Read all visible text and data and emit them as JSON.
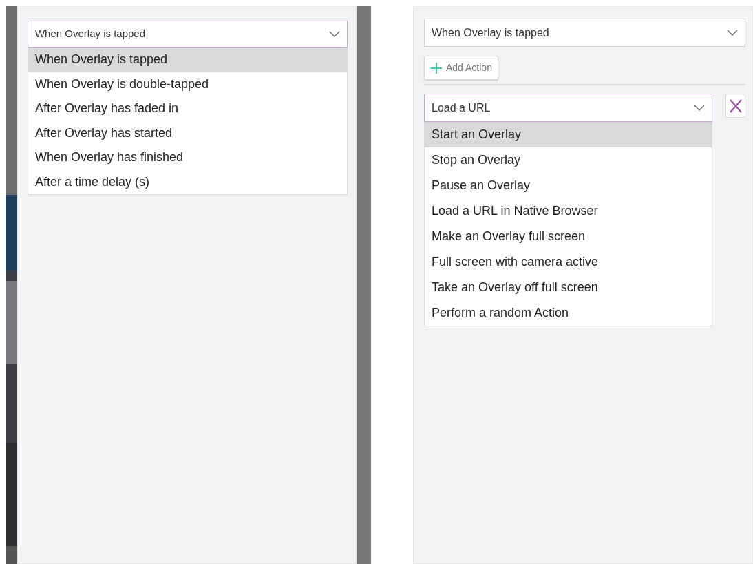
{
  "left_panel": {
    "trigger_select": {
      "value": "When Overlay is tapped",
      "expanded": true
    },
    "trigger_options": [
      {
        "label": "When Overlay is tapped",
        "selected": true
      },
      {
        "label": "When Overlay is double-tapped",
        "selected": false
      },
      {
        "label": "After Overlay has faded in",
        "selected": false
      },
      {
        "label": "After Overlay has started",
        "selected": false
      },
      {
        "label": "When Overlay has finished",
        "selected": false
      },
      {
        "label": "After a time delay (s)",
        "selected": false
      }
    ]
  },
  "right_panel": {
    "trigger_select": {
      "value": "When Overlay is tapped",
      "expanded": false
    },
    "add_action_button": {
      "label": "Add Action"
    },
    "action_select": {
      "value": "Load a URL",
      "expanded": true
    },
    "action_options": [
      {
        "label": "Start an Overlay",
        "selected": true
      },
      {
        "label": "Stop an Overlay",
        "selected": false
      },
      {
        "label": "Pause an Overlay",
        "selected": false
      },
      {
        "label": "Load a URL in Native Browser",
        "selected": false
      },
      {
        "label": "Make an Overlay full screen",
        "selected": false
      },
      {
        "label": "Full screen with camera active",
        "selected": false
      },
      {
        "label": "Take an Overlay off full screen",
        "selected": false
      },
      {
        "label": "Perform a random Action",
        "selected": false
      }
    ]
  }
}
